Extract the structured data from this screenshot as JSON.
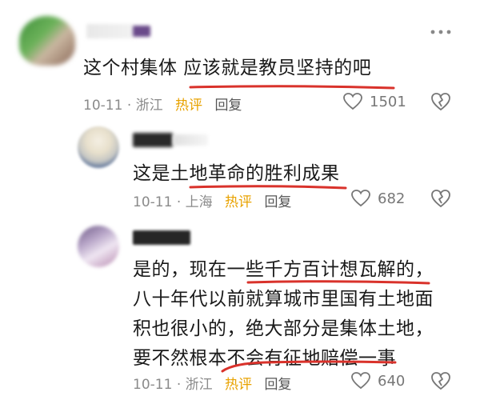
{
  "header": {
    "more_icon": "more-dots-icon"
  },
  "comments": [
    {
      "text": "这个村集体 应该就是教员坚持的吧",
      "meta": {
        "date": "10-11",
        "sep": "·",
        "location": "浙江",
        "hot": "热评",
        "reply": "回复"
      },
      "likes": "1501"
    },
    {
      "text": "这是土地革命的胜利成果",
      "meta": {
        "date": "10-11",
        "sep": "·",
        "location": "上海",
        "hot": "热评",
        "reply": "回复"
      },
      "likes": "682"
    },
    {
      "lines": [
        "是的，现在一些千方百计想瓦解的，",
        "八十年代以前就算城市里国有土地面",
        "积也很小的，绝大部分是集体土地，",
        "要不然根本不会有征地赔偿一事"
      ],
      "meta": {
        "date": "10-11",
        "sep": "·",
        "location": "浙江",
        "hot": "热评",
        "reply": "回复"
      },
      "likes": "640"
    }
  ],
  "colors": {
    "underline": "#d9322b",
    "hot": "#e8a200",
    "meta": "#8a8a8a"
  }
}
